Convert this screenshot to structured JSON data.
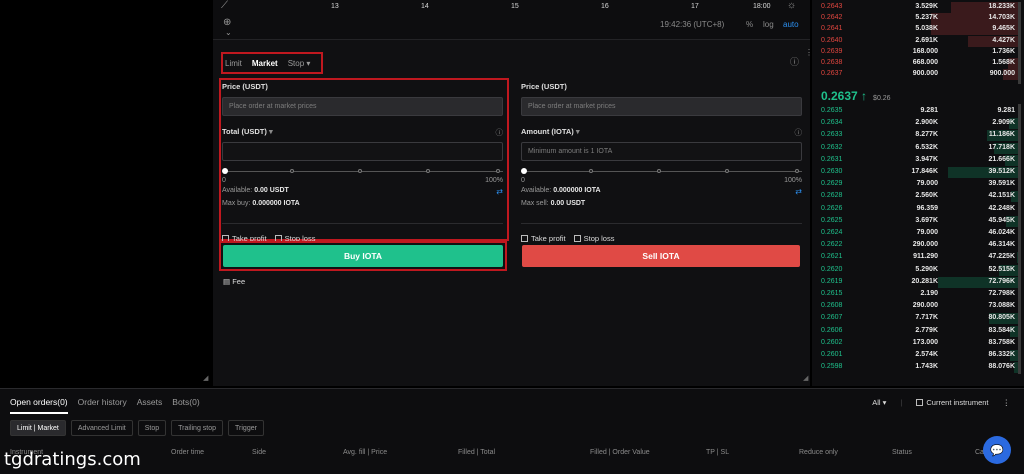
{
  "chart": {
    "ticks": [
      "13",
      "14",
      "15",
      "16",
      "17",
      "18:00"
    ],
    "time": "19:42:36 (UTC+8)",
    "percent": "%",
    "log": "log",
    "auto": "auto"
  },
  "order_form": {
    "tabs": [
      "Limit",
      "Market",
      "Stop"
    ],
    "buy": {
      "price_label": "Price (USDT)",
      "price_placeholder": "Place order at market prices",
      "total_label": "Total (USDT)",
      "slider_min": "0",
      "slider_max": "100%",
      "available_label": "Available:",
      "available_value": "0.00 USDT",
      "max_label": "Max buy:",
      "max_value": "0.000000 IOTA",
      "take_profit": "Take profit",
      "stop_loss": "Stop loss",
      "button": "Buy IOTA"
    },
    "sell": {
      "price_label": "Price (USDT)",
      "price_placeholder": "Place order at market prices",
      "amount_label": "Amount (IOTA)",
      "amount_placeholder": "Minimum amount is 1 IOTA",
      "slider_min": "0",
      "slider_max": "100%",
      "available_label": "Available:",
      "available_value": "0.000000 IOTA",
      "max_label": "Max sell:",
      "max_value": "0.00 USDT",
      "take_profit": "Take profit",
      "stop_loss": "Stop loss",
      "button": "Sell IOTA"
    },
    "fee": "Fee"
  },
  "order_book": {
    "asks": [
      {
        "price": "0.2643",
        "amount": "3.529K",
        "total": "18.233K"
      },
      {
        "price": "0.2642",
        "amount": "5.237K",
        "total": "14.703K"
      },
      {
        "price": "0.2641",
        "amount": "5.038K",
        "total": "9.465K"
      },
      {
        "price": "0.2640",
        "amount": "2.691K",
        "total": "4.427K"
      },
      {
        "price": "0.2639",
        "amount": "168.000",
        "total": "1.736K"
      },
      {
        "price": "0.2638",
        "amount": "668.000",
        "total": "1.568K"
      },
      {
        "price": "0.2637",
        "amount": "900.000",
        "total": "900.000"
      }
    ],
    "mid_price": "0.2637 ↑",
    "mid_usd": "$0.26",
    "bids": [
      {
        "price": "0.2635",
        "amount": "9.281",
        "total": "9.281"
      },
      {
        "price": "0.2634",
        "amount": "2.900K",
        "total": "2.909K"
      },
      {
        "price": "0.2633",
        "amount": "8.277K",
        "total": "11.186K"
      },
      {
        "price": "0.2632",
        "amount": "6.532K",
        "total": "17.718K"
      },
      {
        "price": "0.2631",
        "amount": "3.947K",
        "total": "21.666K"
      },
      {
        "price": "0.2630",
        "amount": "17.846K",
        "total": "39.512K"
      },
      {
        "price": "0.2629",
        "amount": "79.000",
        "total": "39.591K"
      },
      {
        "price": "0.2628",
        "amount": "2.560K",
        "total": "42.151K"
      },
      {
        "price": "0.2626",
        "amount": "96.359",
        "total": "42.248K"
      },
      {
        "price": "0.2625",
        "amount": "3.697K",
        "total": "45.945K"
      },
      {
        "price": "0.2624",
        "amount": "79.000",
        "total": "46.024K"
      },
      {
        "price": "0.2622",
        "amount": "290.000",
        "total": "46.314K"
      },
      {
        "price": "0.2621",
        "amount": "911.290",
        "total": "47.225K"
      },
      {
        "price": "0.2620",
        "amount": "5.290K",
        "total": "52.515K"
      },
      {
        "price": "0.2619",
        "amount": "20.281K",
        "total": "72.796K"
      },
      {
        "price": "0.2615",
        "amount": "2.190",
        "total": "72.798K"
      },
      {
        "price": "0.2608",
        "amount": "290.000",
        "total": "73.088K"
      },
      {
        "price": "0.2607",
        "amount": "7.717K",
        "total": "80.805K"
      },
      {
        "price": "0.2606",
        "amount": "2.779K",
        "total": "83.584K"
      },
      {
        "price": "0.2602",
        "amount": "173.000",
        "total": "83.758K"
      },
      {
        "price": "0.2601",
        "amount": "2.574K",
        "total": "86.332K"
      },
      {
        "price": "0.2598",
        "amount": "1.743K",
        "total": "88.076K"
      }
    ]
  },
  "bottom": {
    "tabs": [
      "Open orders(0)",
      "Order history",
      "Assets",
      "Bots(0)"
    ],
    "all": "All",
    "current_instrument": "Current instrument",
    "filters": [
      "Limit | Market",
      "Advanced Limit",
      "Stop",
      "Trailing stop",
      "Trigger"
    ],
    "columns": [
      "Instrument",
      "Order time",
      "Side",
      "Avg. fill | Price",
      "Filled | Total",
      "Filled | Order Value",
      "TP | SL",
      "Reduce only",
      "Status",
      "Cancel"
    ]
  },
  "watermark": "tgdratings.com"
}
